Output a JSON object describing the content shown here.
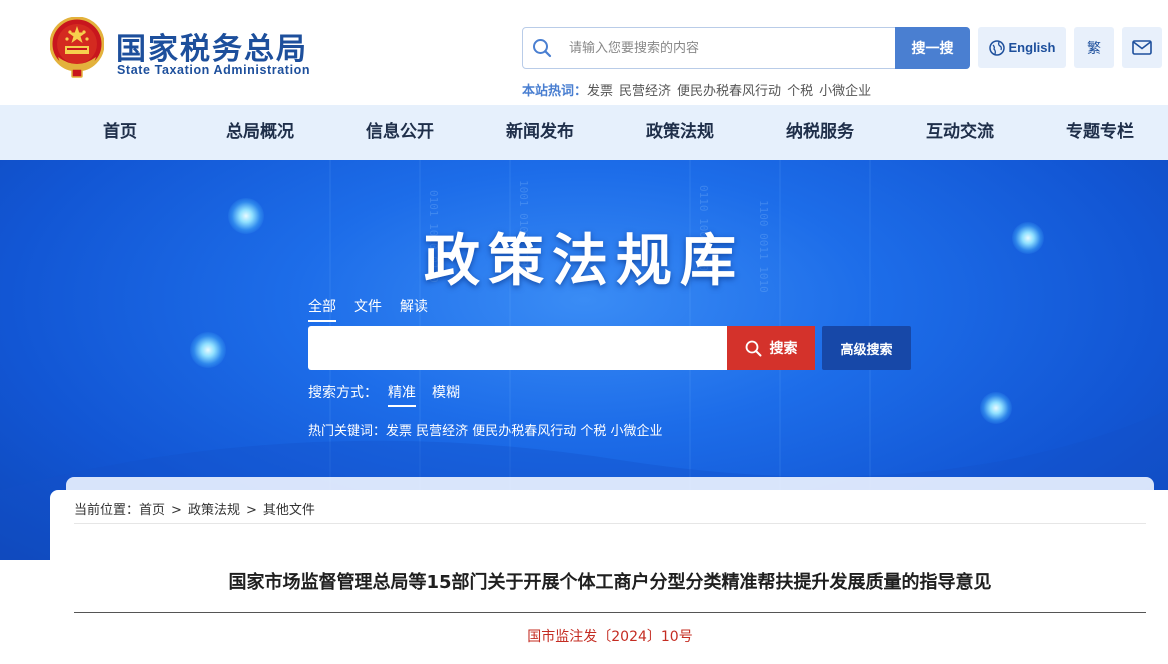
{
  "header": {
    "title": "国家税务总局",
    "subtitle": "State Taxation Administration",
    "search": {
      "placeholder": "请输入您要搜索的内容",
      "button": "搜一搜"
    },
    "lang_label": "English",
    "traditional_label": "繁",
    "hotwords_label": "本站热词：",
    "hotwords": [
      "发票",
      "民营经济",
      "便民办税春风行动",
      "个税",
      "小微企业"
    ]
  },
  "nav": {
    "items": [
      "首页",
      "总局概况",
      "信息公开",
      "新闻发布",
      "政策法规",
      "纳税服务",
      "互动交流",
      "专题专栏"
    ]
  },
  "banner": {
    "title": "政策法规库",
    "tabs": [
      "全部",
      "文件",
      "解读"
    ],
    "active_tab": "全部",
    "search_button": "搜索",
    "advanced_button": "高级搜索",
    "search_mode_label": "搜索方式：",
    "search_modes": [
      "精准",
      "模糊"
    ],
    "hot_keywords_text": "热门关键词：发票 民营经济 便民办税春风行动 个税 小微企业"
  },
  "content": {
    "breadcrumb_label": "当前位置：",
    "breadcrumb": [
      "首页",
      "政策法规",
      "其他文件"
    ],
    "breadcrumb_sep": ">",
    "doc_title": "国家市场监督管理总局等15部门关于开展个体工商户分型分类精准帮扶提升发展质量的指导意见",
    "doc_number": "国市监注发〔2024〕10号"
  },
  "colors": {
    "brand_blue": "#1d4f9c",
    "nav_bg": "#e6f0fc",
    "search_red": "#d4322b",
    "doc_number_red": "#c42c22"
  }
}
